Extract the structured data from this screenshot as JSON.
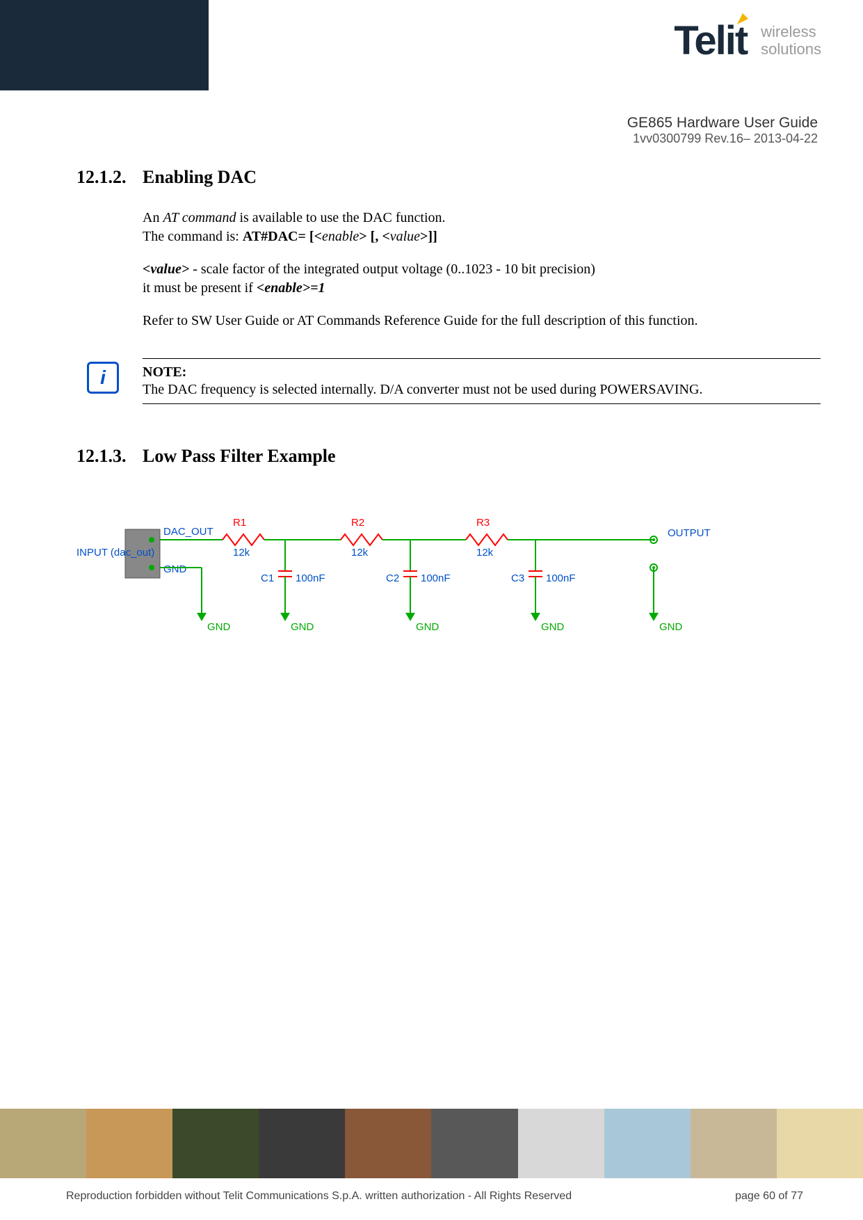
{
  "logo": {
    "brand": "Telit",
    "tagline1": "wireless",
    "tagline2": "solutions"
  },
  "doc": {
    "title": "GE865 Hardware User Guide",
    "rev": "1vv0300799 Rev.16– 2013-04-22"
  },
  "sec1": {
    "num": "12.1.2.",
    "title": "Enabling DAC",
    "p1a": "An ",
    "p1b": "AT command",
    "p1c": " is available to use the DAC function.",
    "p2a": "The command is:    ",
    "p2b": "AT#DAC= [<",
    "p2c": "enable",
    "p2d": "> [, <",
    "p2e": "value",
    "p2f": ">]]",
    "p3a": "<value>",
    "p3b": " - scale factor of the integrated output voltage (0..1023 - 10 bit precision)",
    "p4a": "it must be present if ",
    "p4b": "<enable>=1",
    "p5": "Refer to SW User Guide or AT Commands Reference Guide for the full description of this function."
  },
  "note": {
    "label": "NOTE:",
    "text": "The DAC frequency is selected internally. D/A converter must not be used during POWERSAVING."
  },
  "sec2": {
    "num": "12.1.3.",
    "title": "Low Pass Filter Example"
  },
  "diagram": {
    "input_label": "INPUT (dac_out)",
    "dac_out": "DAC_OUT",
    "gnd_pin": "GND",
    "output": "OUTPUT",
    "r1": "R1",
    "r1v": "12k",
    "r2": "R2",
    "r2v": "12k",
    "r3": "R3",
    "r3v": "12k",
    "c1": "C1",
    "c1v": "100nF",
    "c2": "C2",
    "c2v": "100nF",
    "c3": "C3",
    "c3v": "100nF",
    "gnd": "GND"
  },
  "footer": {
    "copyright": "Reproduction forbidden without Telit Communications S.p.A. written authorization - All Rights Reserved",
    "page": "page 60 of 77"
  }
}
